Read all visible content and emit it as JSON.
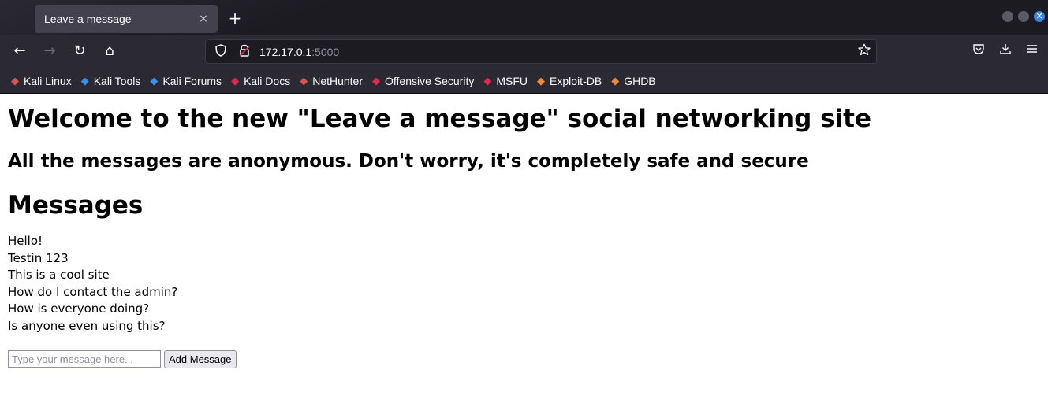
{
  "browser": {
    "tab": {
      "title": "Leave a message",
      "close_glyph": "×"
    },
    "new_tab_glyph": "+",
    "window_controls": {
      "close_glyph": "✕"
    },
    "nav": {
      "back_glyph": "←",
      "forward_glyph": "→",
      "reload_glyph": "↻",
      "home_glyph": "⌂"
    },
    "url": {
      "host": "172.17.0.1",
      "port": ":5000"
    },
    "toolbar_icons": {
      "pocket": "pocket-icon",
      "download": "download-icon",
      "menu": "menu-icon"
    },
    "bookmarks": [
      {
        "label": "Kali Linux",
        "icon": "kali-dragon-icon",
        "color": "#d9534f"
      },
      {
        "label": "Kali Tools",
        "icon": "kali-tools-icon",
        "color": "#3b8eea"
      },
      {
        "label": "Kali Forums",
        "icon": "kali-forums-icon",
        "color": "#3b8eea"
      },
      {
        "label": "Kali Docs",
        "icon": "kali-docs-icon",
        "color": "#e22850"
      },
      {
        "label": "NetHunter",
        "icon": "nethunter-icon",
        "color": "#d9534f"
      },
      {
        "label": "Offensive Security",
        "icon": "offsec-icon",
        "color": "#e22850"
      },
      {
        "label": "MSFU",
        "icon": "msfu-icon",
        "color": "#e22850"
      },
      {
        "label": "Exploit-DB",
        "icon": "exploit-db-icon",
        "color": "#f0883e"
      },
      {
        "label": "GHDB",
        "icon": "ghdb-icon",
        "color": "#f0883e"
      }
    ]
  },
  "page": {
    "title": "Welcome to the new \"Leave a message\" social networking site",
    "subtitle": "All the messages are anonymous. Don't worry, it's completely safe and secure",
    "messages_heading": "Messages",
    "messages": [
      "Hello!",
      "Testin 123",
      "This is a cool site",
      "How do I contact the admin?",
      "How is everyone doing?",
      "Is anyone even using this?"
    ],
    "form": {
      "input_placeholder": "Type your message here...",
      "input_value": "",
      "submit_label": "Add Message"
    }
  }
}
